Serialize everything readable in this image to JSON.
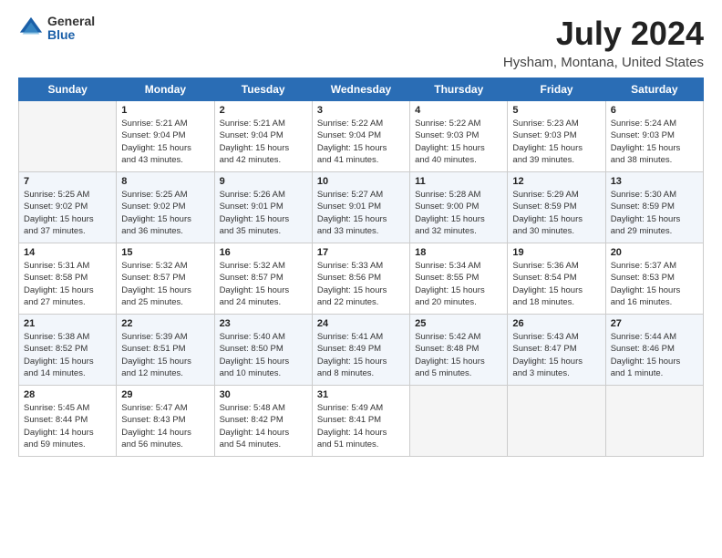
{
  "logo": {
    "general": "General",
    "blue": "Blue"
  },
  "title": "July 2024",
  "subtitle": "Hysham, Montana, United States",
  "days_header": [
    "Sunday",
    "Monday",
    "Tuesday",
    "Wednesday",
    "Thursday",
    "Friday",
    "Saturday"
  ],
  "weeks": [
    [
      {
        "num": "",
        "info": ""
      },
      {
        "num": "1",
        "info": "Sunrise: 5:21 AM\nSunset: 9:04 PM\nDaylight: 15 hours\nand 43 minutes."
      },
      {
        "num": "2",
        "info": "Sunrise: 5:21 AM\nSunset: 9:04 PM\nDaylight: 15 hours\nand 42 minutes."
      },
      {
        "num": "3",
        "info": "Sunrise: 5:22 AM\nSunset: 9:04 PM\nDaylight: 15 hours\nand 41 minutes."
      },
      {
        "num": "4",
        "info": "Sunrise: 5:22 AM\nSunset: 9:03 PM\nDaylight: 15 hours\nand 40 minutes."
      },
      {
        "num": "5",
        "info": "Sunrise: 5:23 AM\nSunset: 9:03 PM\nDaylight: 15 hours\nand 39 minutes."
      },
      {
        "num": "6",
        "info": "Sunrise: 5:24 AM\nSunset: 9:03 PM\nDaylight: 15 hours\nand 38 minutes."
      }
    ],
    [
      {
        "num": "7",
        "info": "Sunrise: 5:25 AM\nSunset: 9:02 PM\nDaylight: 15 hours\nand 37 minutes."
      },
      {
        "num": "8",
        "info": "Sunrise: 5:25 AM\nSunset: 9:02 PM\nDaylight: 15 hours\nand 36 minutes."
      },
      {
        "num": "9",
        "info": "Sunrise: 5:26 AM\nSunset: 9:01 PM\nDaylight: 15 hours\nand 35 minutes."
      },
      {
        "num": "10",
        "info": "Sunrise: 5:27 AM\nSunset: 9:01 PM\nDaylight: 15 hours\nand 33 minutes."
      },
      {
        "num": "11",
        "info": "Sunrise: 5:28 AM\nSunset: 9:00 PM\nDaylight: 15 hours\nand 32 minutes."
      },
      {
        "num": "12",
        "info": "Sunrise: 5:29 AM\nSunset: 8:59 PM\nDaylight: 15 hours\nand 30 minutes."
      },
      {
        "num": "13",
        "info": "Sunrise: 5:30 AM\nSunset: 8:59 PM\nDaylight: 15 hours\nand 29 minutes."
      }
    ],
    [
      {
        "num": "14",
        "info": "Sunrise: 5:31 AM\nSunset: 8:58 PM\nDaylight: 15 hours\nand 27 minutes."
      },
      {
        "num": "15",
        "info": "Sunrise: 5:32 AM\nSunset: 8:57 PM\nDaylight: 15 hours\nand 25 minutes."
      },
      {
        "num": "16",
        "info": "Sunrise: 5:32 AM\nSunset: 8:57 PM\nDaylight: 15 hours\nand 24 minutes."
      },
      {
        "num": "17",
        "info": "Sunrise: 5:33 AM\nSunset: 8:56 PM\nDaylight: 15 hours\nand 22 minutes."
      },
      {
        "num": "18",
        "info": "Sunrise: 5:34 AM\nSunset: 8:55 PM\nDaylight: 15 hours\nand 20 minutes."
      },
      {
        "num": "19",
        "info": "Sunrise: 5:36 AM\nSunset: 8:54 PM\nDaylight: 15 hours\nand 18 minutes."
      },
      {
        "num": "20",
        "info": "Sunrise: 5:37 AM\nSunset: 8:53 PM\nDaylight: 15 hours\nand 16 minutes."
      }
    ],
    [
      {
        "num": "21",
        "info": "Sunrise: 5:38 AM\nSunset: 8:52 PM\nDaylight: 15 hours\nand 14 minutes."
      },
      {
        "num": "22",
        "info": "Sunrise: 5:39 AM\nSunset: 8:51 PM\nDaylight: 15 hours\nand 12 minutes."
      },
      {
        "num": "23",
        "info": "Sunrise: 5:40 AM\nSunset: 8:50 PM\nDaylight: 15 hours\nand 10 minutes."
      },
      {
        "num": "24",
        "info": "Sunrise: 5:41 AM\nSunset: 8:49 PM\nDaylight: 15 hours\nand 8 minutes."
      },
      {
        "num": "25",
        "info": "Sunrise: 5:42 AM\nSunset: 8:48 PM\nDaylight: 15 hours\nand 5 minutes."
      },
      {
        "num": "26",
        "info": "Sunrise: 5:43 AM\nSunset: 8:47 PM\nDaylight: 15 hours\nand 3 minutes."
      },
      {
        "num": "27",
        "info": "Sunrise: 5:44 AM\nSunset: 8:46 PM\nDaylight: 15 hours\nand 1 minute."
      }
    ],
    [
      {
        "num": "28",
        "info": "Sunrise: 5:45 AM\nSunset: 8:44 PM\nDaylight: 14 hours\nand 59 minutes."
      },
      {
        "num": "29",
        "info": "Sunrise: 5:47 AM\nSunset: 8:43 PM\nDaylight: 14 hours\nand 56 minutes."
      },
      {
        "num": "30",
        "info": "Sunrise: 5:48 AM\nSunset: 8:42 PM\nDaylight: 14 hours\nand 54 minutes."
      },
      {
        "num": "31",
        "info": "Sunrise: 5:49 AM\nSunset: 8:41 PM\nDaylight: 14 hours\nand 51 minutes."
      },
      {
        "num": "",
        "info": ""
      },
      {
        "num": "",
        "info": ""
      },
      {
        "num": "",
        "info": ""
      }
    ]
  ]
}
